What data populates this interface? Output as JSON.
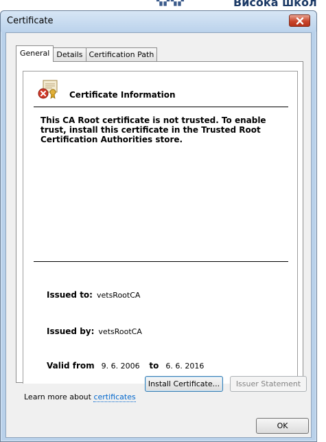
{
  "background": {
    "text": "Висока школ"
  },
  "window": {
    "title": "Certificate"
  },
  "tabs": [
    {
      "label": "General"
    },
    {
      "label": "Details"
    },
    {
      "label": "Certification Path"
    }
  ],
  "cert": {
    "heading": "Certificate Information",
    "message": "This CA Root certificate is not trusted. To enable trust, install this certificate in the Trusted Root Certification Authorities store.",
    "issued_to_label": "Issued to:",
    "issued_to": "vetsRootCA",
    "issued_by_label": "Issued by:",
    "issued_by": "vetsRootCA",
    "valid_from_label": "Valid from",
    "valid_from": "9. 6. 2006",
    "to_label": "to",
    "valid_to": "6. 6. 2016",
    "icon": "certificate-error-icon"
  },
  "buttons": {
    "install": "Install Certificate...",
    "issuer_statement": "Issuer Statement",
    "ok": "OK"
  },
  "learn": {
    "prefix": "Learn more about ",
    "link": "certificates"
  },
  "colors": {
    "title_bar": "#bcd3ec",
    "close": "#c9462c",
    "link": "#0066cc"
  }
}
